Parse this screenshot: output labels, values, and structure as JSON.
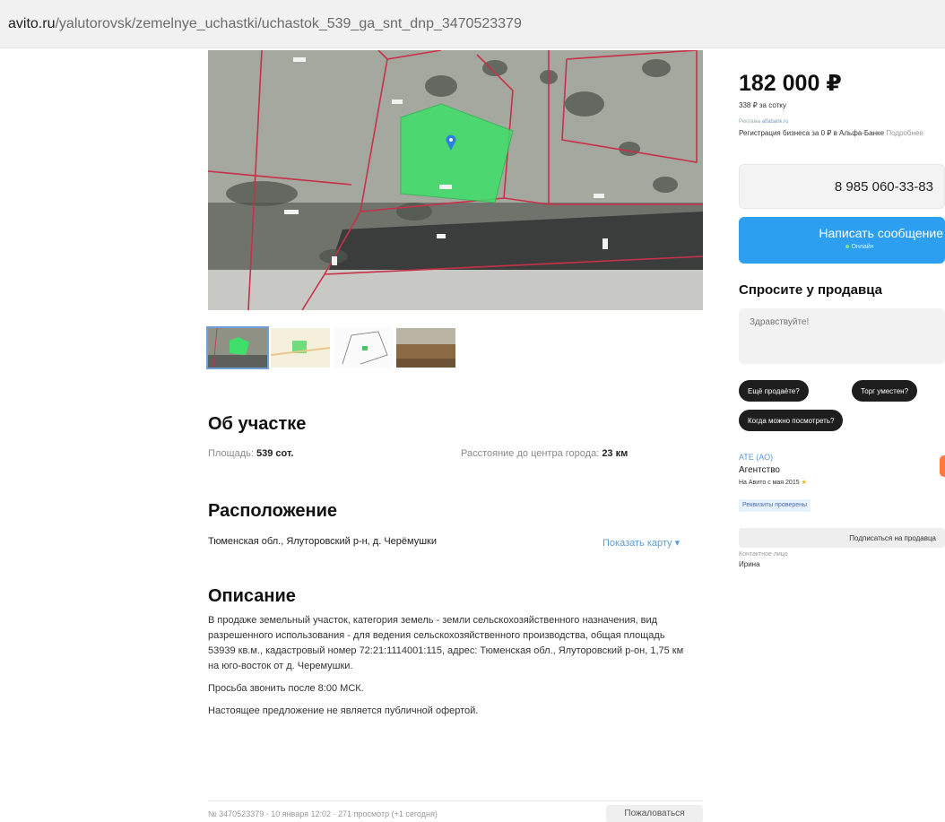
{
  "browser": {
    "url_host": "avito.ru",
    "url_path": "/yalutorovsk/zemelnye_uchastki/uchastok_539_ga_snt_dnp_3470523379"
  },
  "listing": {
    "section_about": "Об участке",
    "area_label": "Площадь:",
    "area_value": "539 сот.",
    "distance_label": "Расстояние до центра города:",
    "distance_value": "23 км",
    "section_location": "Расположение",
    "address": "Тюменская обл., Ялуторовский р-н, д. Черёмушки",
    "show_map": "Показать карту ▾",
    "section_description": "Описание",
    "description": [
      "В продаже земельный участок, категория земель - земли сельскохозяйственного назначения, вид разрешенного использования - для ведения сельскохозяйственного производства, общая площадь 53939 кв.м., кадастровый номер 72:21:1114001:115, адрес: Тюменская обл., Ялуторовский р-он, 1,75 км на юго-восток от д. Черемушки.",
      "Просьба звонить после 8:00 МСК.",
      "Настоящее предложение не является публичной офертой."
    ],
    "meta": "№ 3470523379 · 10 января 12:02 · 271 просмотр (+1 сегодня)",
    "complain": "Пожаловаться"
  },
  "sidebar": {
    "price": "182 000 ₽",
    "price_per": "338 ₽ за сотку",
    "ad_label": "Реклама",
    "ad_site": "alfabank.ru",
    "ad_text": "Регистрация бизнеса за 0 ₽ в Альфа-Банке",
    "ad_more": "Подробнее",
    "phone": "8 985 060-33-83",
    "message_button": "Написать сообщение",
    "online": "Онлайн",
    "ask_title": "Спросите у продавца",
    "ask_placeholder": "Здравствуйте!",
    "chips": [
      "Ещё продаёте?",
      "Торг уместен?",
      "Когда можно посмотреть?"
    ],
    "seller_name": "АТЕ (АО)",
    "seller_type": "Агентство",
    "seller_since": "На Авито с мая 2015",
    "verified": "Реквизиты проверены",
    "subscribe": "Подписаться на продавца",
    "contact_label": "Контактное лицо",
    "contact_name": "Ирина"
  },
  "colors": {
    "accent": "#2d9ff0",
    "link": "#5b9bd5",
    "plot": "#3ee06a",
    "boundary": "#c8314a"
  }
}
